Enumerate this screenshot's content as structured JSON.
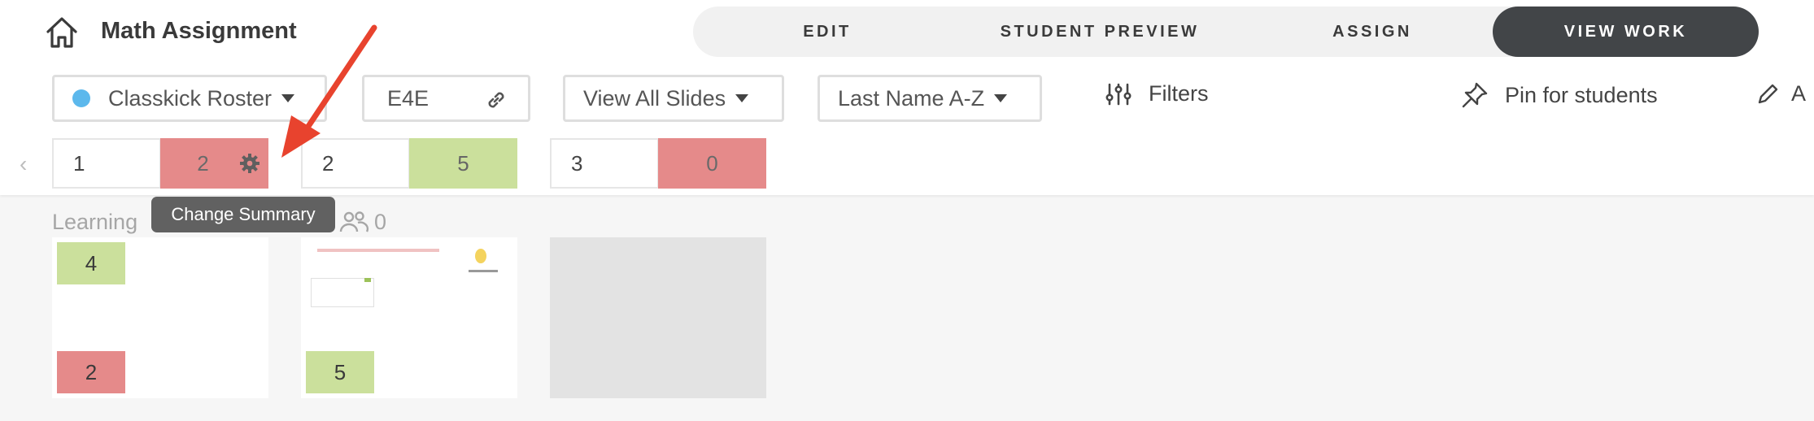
{
  "header": {
    "title": "Math Assignment",
    "tabs": [
      {
        "label": "EDIT"
      },
      {
        "label": "STUDENT PREVIEW"
      },
      {
        "label": "ASSIGN"
      },
      {
        "label": "VIEW WORK",
        "active": true
      }
    ]
  },
  "toolbar": {
    "roster": "Classkick Roster",
    "code": "E4E",
    "slides_filter": "View All Slides",
    "sort": "Last Name A-Z",
    "filters": "Filters",
    "pin": "Pin for students",
    "cutoff_text": "A"
  },
  "summary": [
    {
      "index": "1",
      "value": "2",
      "status": "red"
    },
    {
      "index": "2",
      "value": "5",
      "status": "green"
    },
    {
      "index": "3",
      "value": "0",
      "status": "red"
    }
  ],
  "tooltip": "Change Summary",
  "learning": {
    "label": "Learning",
    "student_count": "0"
  },
  "slides": [
    {
      "top_badge": "4",
      "bottom_badge": "2"
    },
    {
      "bottom_badge": "5"
    }
  ],
  "colors": {
    "accent_dark": "#424548",
    "red": "#e58a8a",
    "green": "#cbe09c",
    "roster_dot": "#5cb8ec",
    "arrow": "#e8432e"
  }
}
